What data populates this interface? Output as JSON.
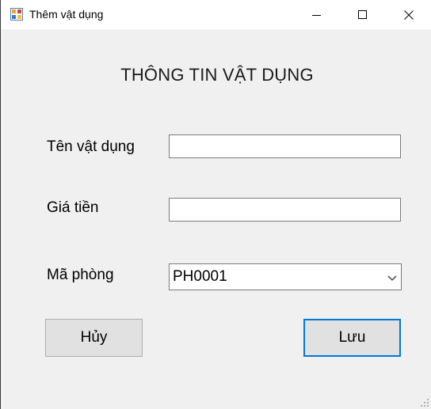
{
  "window": {
    "title": "Thêm vật dụng",
    "title_icon": "app-window-icon",
    "controls": {
      "minimize": "minimize-icon",
      "maximize": "maximize-icon",
      "close": "close-icon"
    }
  },
  "form": {
    "heading": "THÔNG TIN VẬT DỤNG",
    "name_label": "Tên vật dụng",
    "name_value": "",
    "price_label": "Giá tiền",
    "price_value": "",
    "room_label": "Mã phòng",
    "room_selected": "PH0001",
    "room_arrow_icon": "chevron-down-icon"
  },
  "buttons": {
    "cancel_label": "Hủy",
    "save_label": "Lưu"
  },
  "colors": {
    "window_bg": "#f0f0f0",
    "titlebar_bg": "#ffffff",
    "button_bg": "#e1e1e1",
    "focus_border": "#0078d7"
  }
}
